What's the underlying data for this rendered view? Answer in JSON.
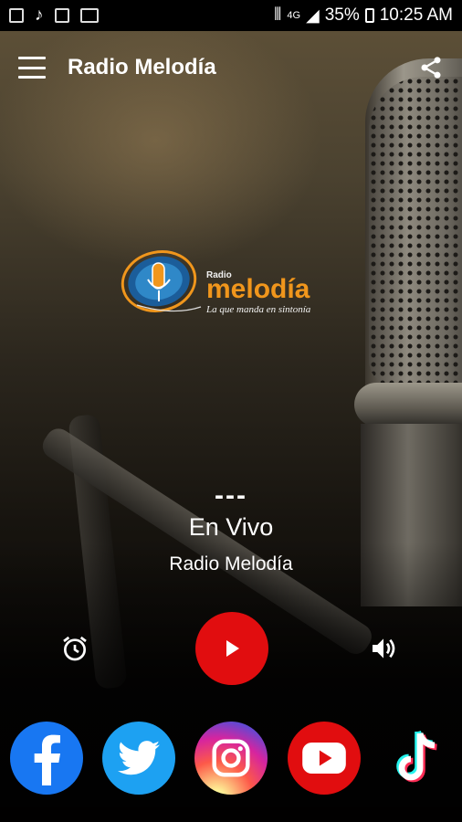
{
  "status_bar": {
    "battery": "35%",
    "time": "10:25 AM",
    "network": "4G"
  },
  "app_bar": {
    "title": "Radio Melodía"
  },
  "logo": {
    "small": "Radio",
    "main": "melodía",
    "tagline": "La que manda en sintonía"
  },
  "now_playing": {
    "separator": "---",
    "title": "En Vivo",
    "station": "Radio Melodía"
  },
  "colors": {
    "play_button": "#e10d0f",
    "facebook": "#1877f2",
    "twitter": "#1da1f2",
    "youtube": "#e10d0f",
    "logo_orange": "#f0961c",
    "logo_blue": "#1b5d9a"
  },
  "icons": {
    "menu": "hamburger-menu-icon",
    "share": "share-icon",
    "alarm": "alarm-clock-icon",
    "play": "play-icon",
    "volume": "volume-icon",
    "socials": [
      "facebook-icon",
      "twitter-icon",
      "instagram-icon",
      "youtube-icon",
      "tiktok-icon"
    ]
  }
}
